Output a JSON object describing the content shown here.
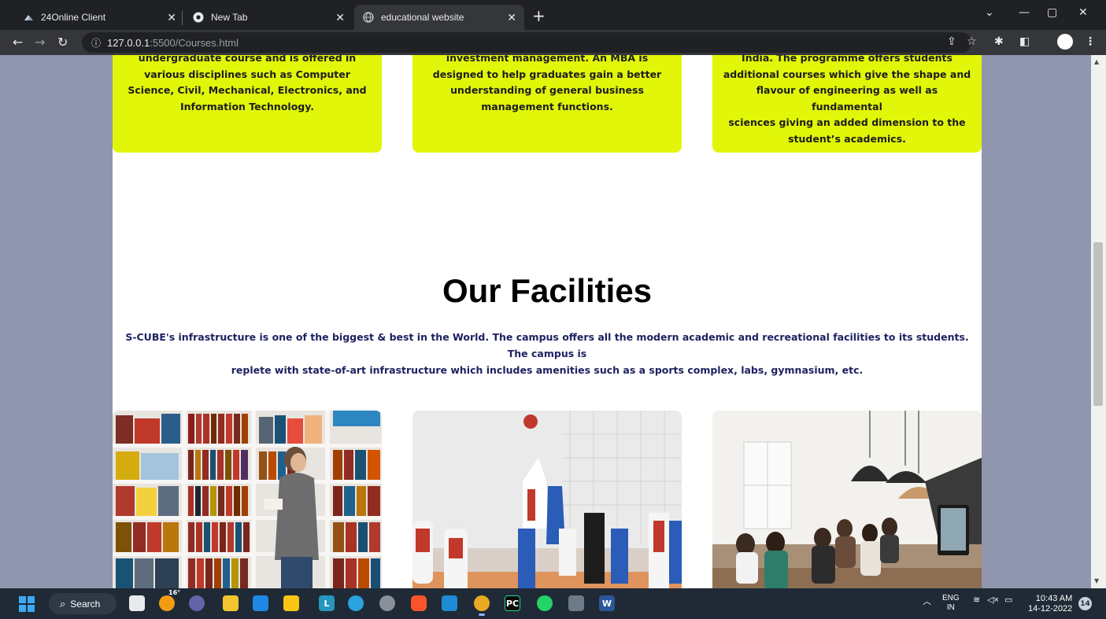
{
  "browser": {
    "tabs": [
      {
        "title": "24Online Client",
        "icon": "cloud-icon"
      },
      {
        "title": "New Tab",
        "icon": "chrome-icon"
      },
      {
        "title": "educational website",
        "icon": "globe-icon",
        "active": true
      }
    ],
    "url_host": "127.0.0.1",
    "url_path": ":5500/Courses.html"
  },
  "page": {
    "cards": [
      {
        "lines": [
          "undergraduate course and is offered in",
          "various disciplines such as Computer",
          "Science, Civil, Mechanical, Electronics, and",
          "Information Technology."
        ]
      },
      {
        "lines": [
          "investment management. An MBA is",
          "designed to help graduates gain a better",
          "understanding of general business",
          "management functions."
        ]
      },
      {
        "lines": [
          "India. The programme offers students",
          "additional courses which give the shape and",
          "flavour of engineering as well as fundamental",
          "sciences giving an added dimension to the",
          "student’s academics."
        ]
      }
    ],
    "facilities_title": "Our Facilities",
    "facilities_desc_line1": "S-CUBE's infrastructure is one of the biggest & best in the World. The campus offers all the modern academic and recreational facilities to its students. The campus is",
    "facilities_desc_line2": "replete with state-of-art infrastructure which includes amenities such as a sports complex, labs, gymnasium, etc.",
    "card_color": "#e1f608",
    "side_bg": "#9096ad"
  },
  "taskbar": {
    "search_label": "Search",
    "weather_temp": "16°",
    "lang_line1": "ENG",
    "lang_line2": "IN",
    "time": "10:43 AM",
    "date": "14-12-2022",
    "notification_count": "14"
  }
}
